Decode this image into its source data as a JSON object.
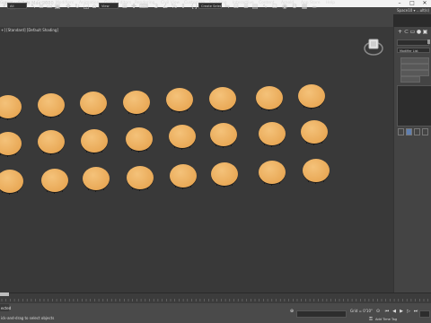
{
  "window": {
    "title": "utodesk 3ds Max 2020",
    "minimize": "–",
    "maximize": "□",
    "close": "✕"
  },
  "menus": [
    "Group",
    "Views",
    "Create",
    "Modifiers",
    "Animation",
    "Graph Editors",
    "Rendering",
    "Civil View",
    "Customize",
    "Scripting",
    "Interactive",
    "Content",
    "Arnold",
    "App Store",
    "Help"
  ],
  "account": "Space10 ▾  ...ult(s)",
  "toolbar": {
    "filter_value": "All",
    "view_value": "View",
    "selection_set": "Create Selection Set"
  },
  "viewport": {
    "label": "+] [Standard] [Default Shading]"
  },
  "command_panel": {
    "tabs": [
      "+",
      "⊂",
      "▭",
      "●",
      "▣",
      "🔧"
    ],
    "modifier_list": "Modifier List"
  },
  "status": {
    "selection_line": "ected",
    "prompt": "ick-and-drag to select objects",
    "grid": "Grid = 0'10\"",
    "add_time_tag": "Add Time Tag"
  },
  "objects": {
    "count": 24
  }
}
